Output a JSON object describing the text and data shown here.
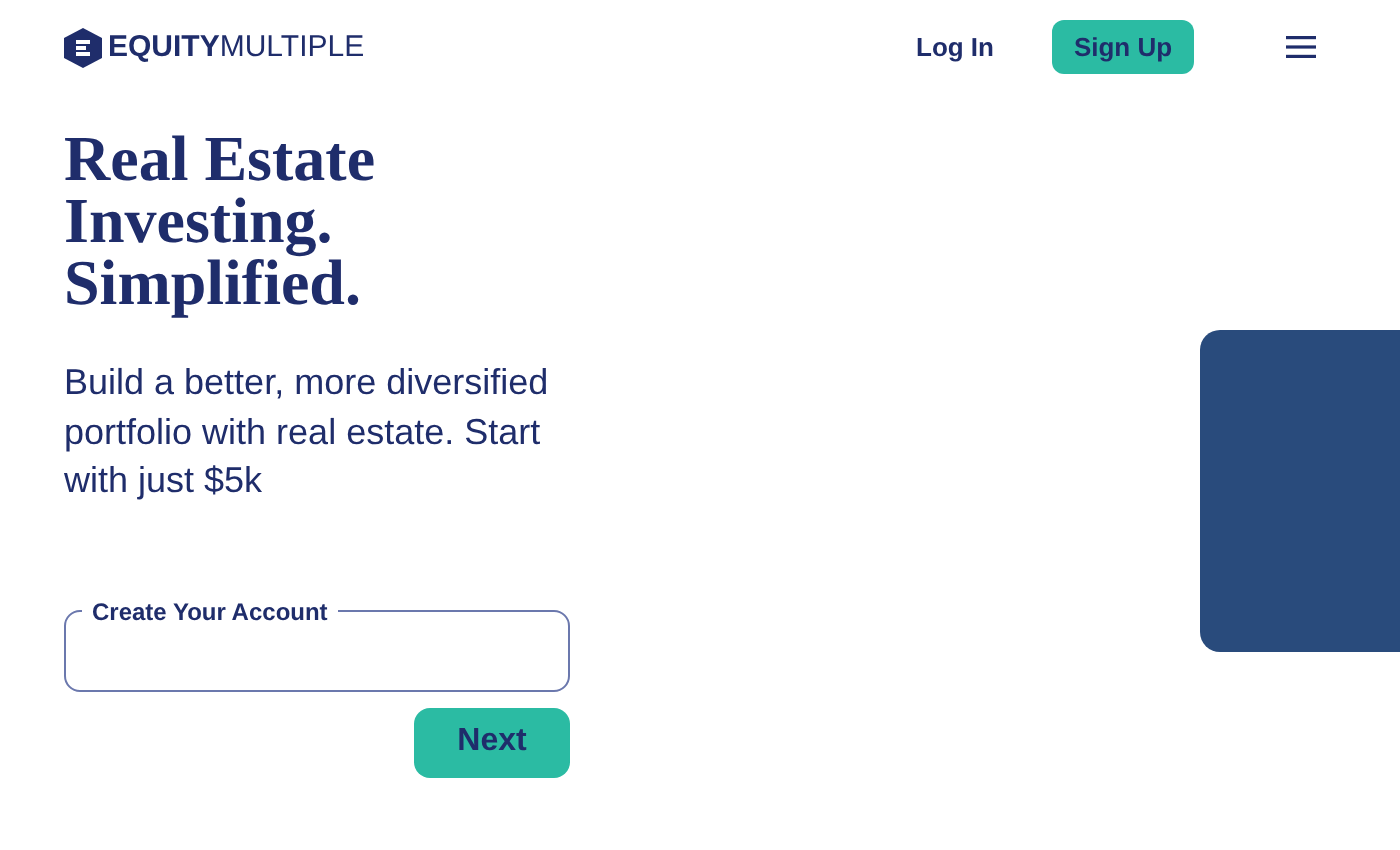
{
  "header": {
    "logo": "**EQUITY**MULTIPLE",
    "login": "Log In",
    "signup": "Sign Up"
  },
  "hero": {
    "title": [
      "Real Estate",
      "Investing.",
      "Simplified."
    ],
    "subtitle": "Build a better, more diversified portfolio with real estate. Start with just $5k"
  },
  "form": {
    "label": "Create Your Account",
    "button": "Next"
  }
}
